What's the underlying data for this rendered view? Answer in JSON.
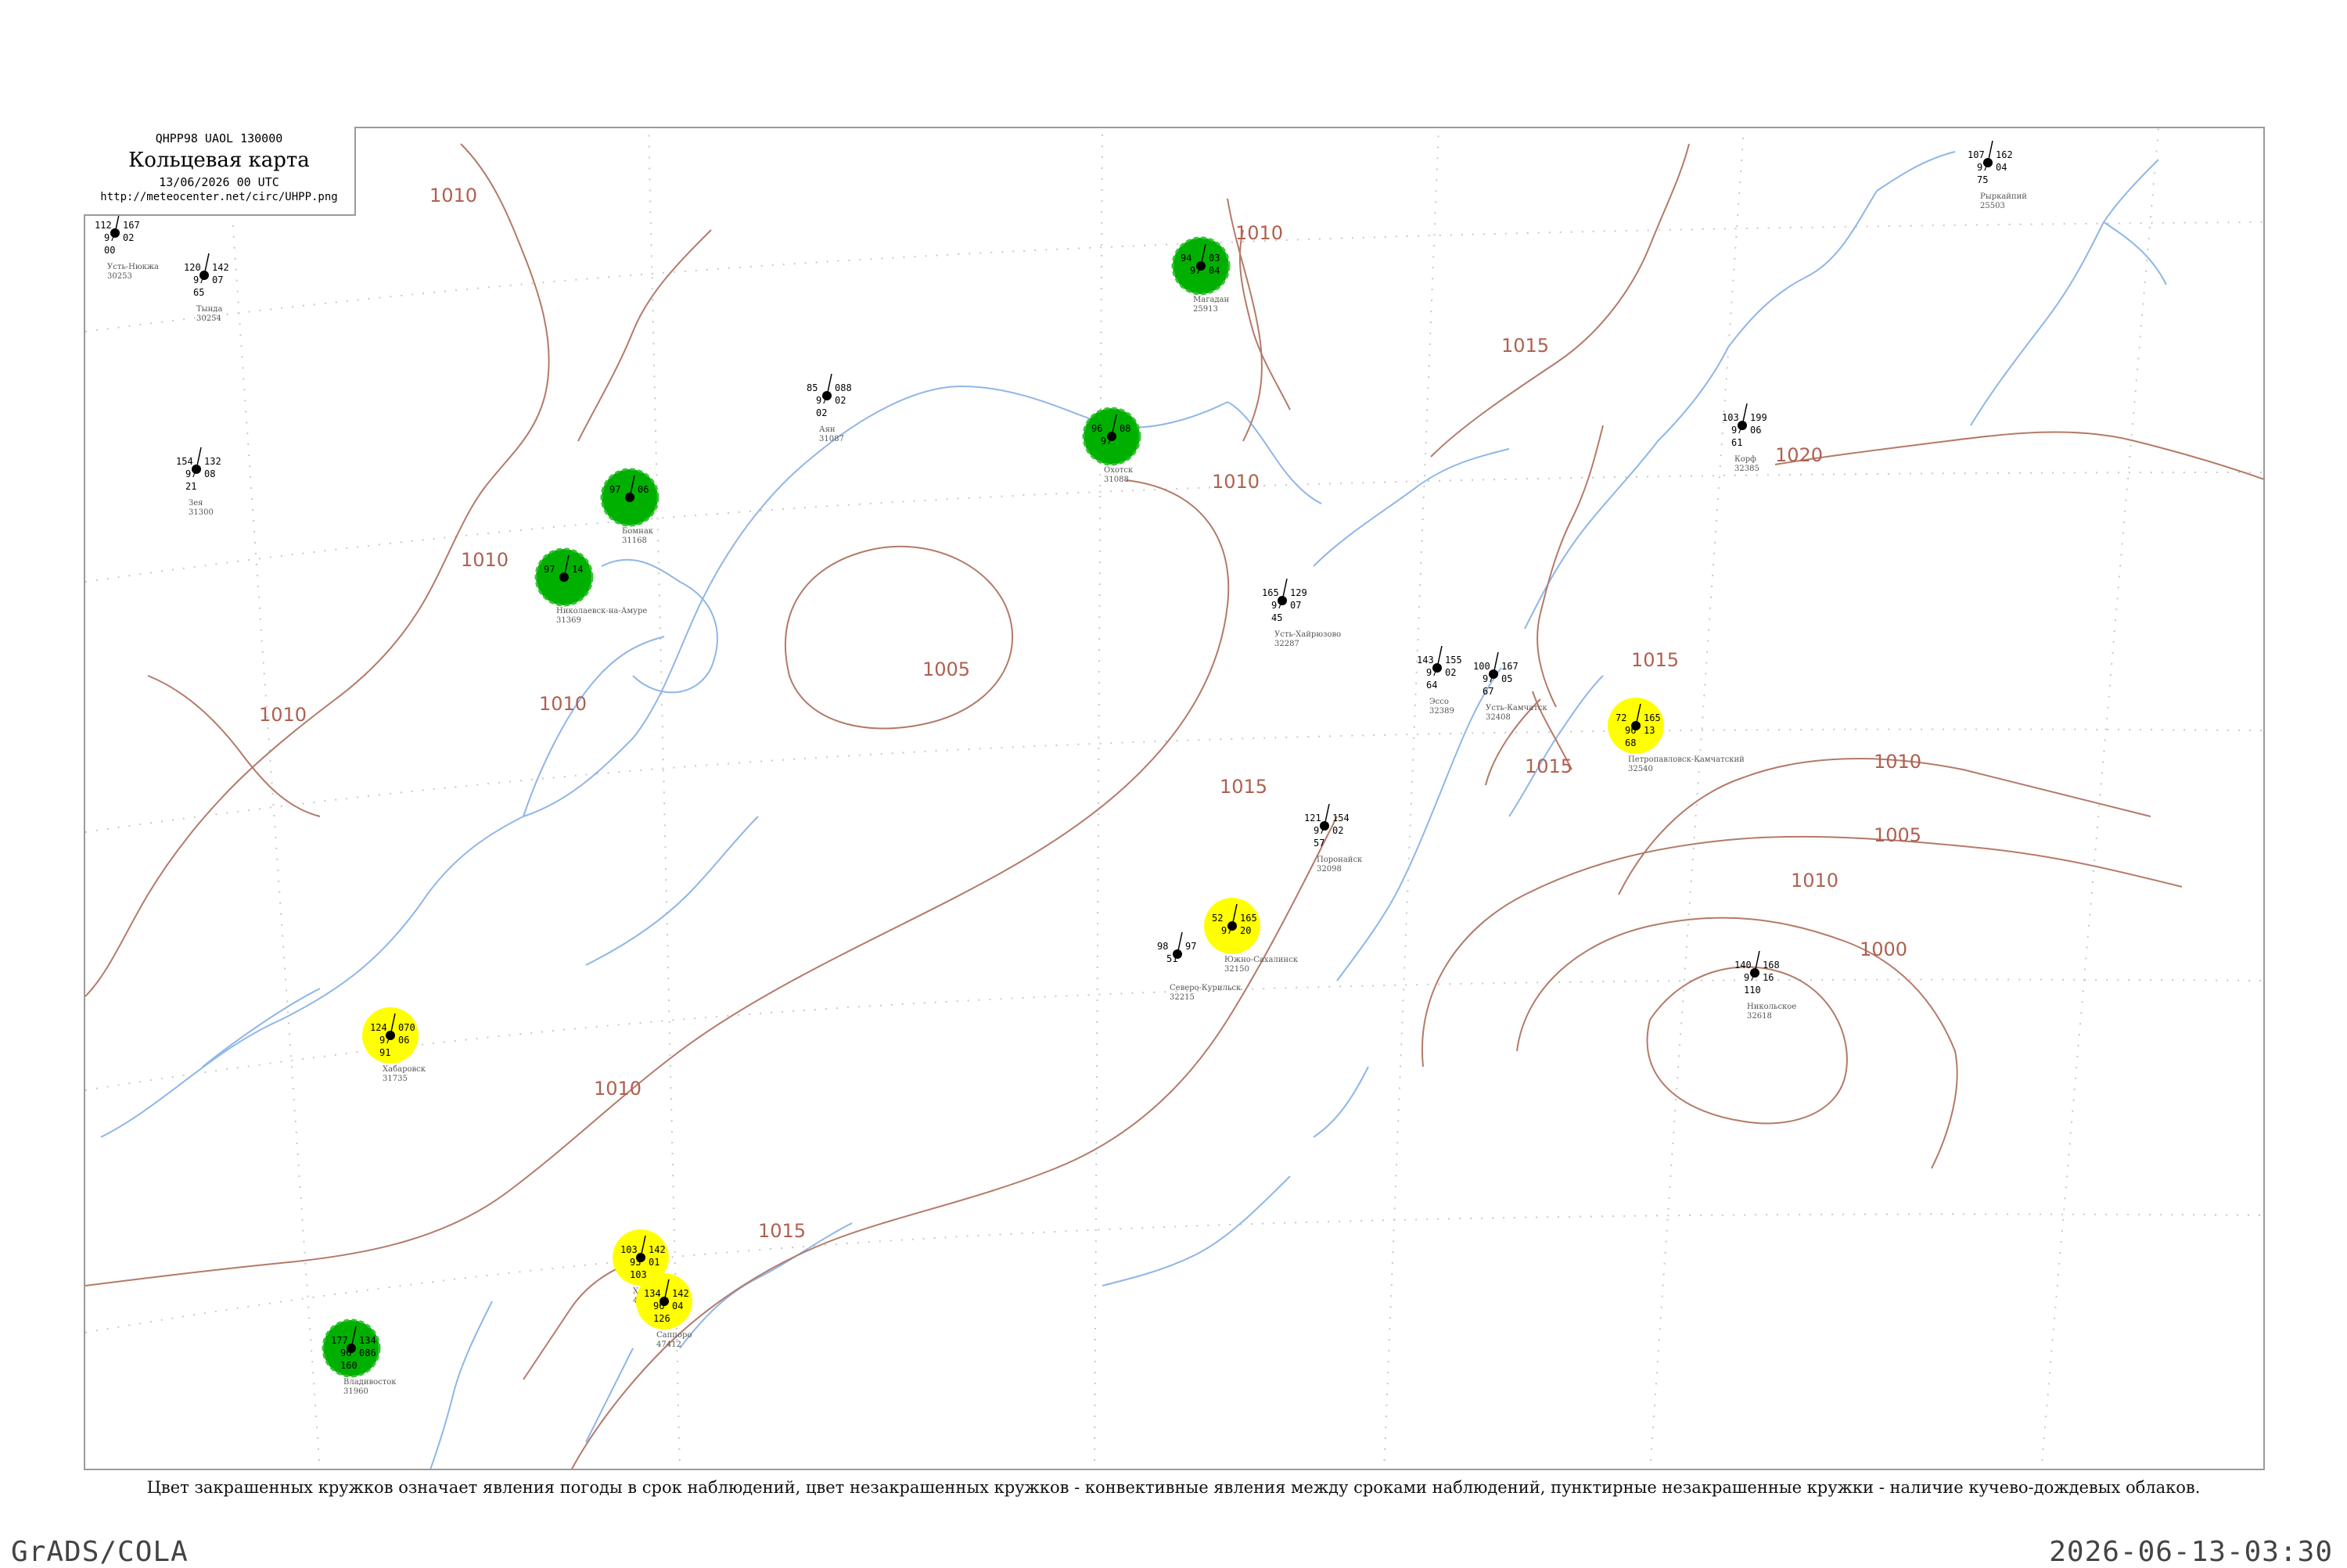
{
  "legend": {
    "code": "QHPP98  UAOL  130000",
    "title": "Кольцевая карта",
    "date": "13/06/2026 00 UTC",
    "url": "http://meteocenter.net/circ/UHPP.png"
  },
  "footnote": "Цвет закрашенных кружков означает явления погоды в срок наблюдений, цвет незакрашенных кружков - конвективные явления между сроками наблюдений, пунктирные незакрашенные кружки - наличие кучево-дождевых облаков.",
  "credit": "GrADS/COLA",
  "timestamp": "2026-06-13-03:30",
  "colors": {
    "isobar": "#b47a6a",
    "coast": "#8fb6e8",
    "green_fill": "#00b000",
    "green_ring": "#36c436",
    "yellow_fill": "#ffff00",
    "red_ring": "#e0506e",
    "grid": "#c8c8c8"
  },
  "isobar_labels": [
    "1010",
    "1010",
    "1010",
    "1010",
    "1010",
    "1010",
    "1005",
    "1010",
    "1015",
    "1015",
    "1015",
    "1020",
    "1015",
    "1010",
    "1005",
    "1000",
    "1015",
    "1010"
  ],
  "stations": [
    {
      "name": "Усть-Нюкжа",
      "id": "30253",
      "values": [
        "112",
        "167",
        "97",
        "02",
        "00"
      ],
      "marker": "none"
    },
    {
      "name": "Тында",
      "id": "30254",
      "values": [
        "120",
        "142",
        "97",
        "07",
        "65"
      ],
      "marker": "none"
    },
    {
      "name": "Зея",
      "id": "31300",
      "values": [
        "154",
        "132",
        "97",
        "08",
        "21"
      ],
      "marker": "none"
    },
    {
      "name": "Бомнак",
      "id": "31168",
      "values": [
        "97",
        "06"
      ],
      "marker": "filled-green"
    },
    {
      "name": "Николаевск-на-Амуре",
      "id": "31369",
      "values": [
        "97",
        "14"
      ],
      "marker": "filled-green"
    },
    {
      "name": "Охотск",
      "id": "31088",
      "values": [
        "96",
        "08",
        "97"
      ],
      "marker": "filled-green"
    },
    {
      "name": "Аян",
      "id": "31087",
      "values": [
        "85",
        "088",
        "97",
        "02",
        "02"
      ],
      "marker": "none"
    },
    {
      "name": "Магадан",
      "id": "25913",
      "values": [
        "94",
        "03",
        "97",
        "04"
      ],
      "marker": "filled-green"
    },
    {
      "name": "Хабаровск",
      "id": "31735",
      "values": [
        "124",
        "070",
        "97",
        "06",
        "91"
      ],
      "marker": "filled-yellow"
    },
    {
      "name": "Владивосток",
      "id": "31960",
      "values": [
        "177",
        "134",
        "96",
        "086",
        "160"
      ],
      "marker": "filled-green"
    },
    {
      "name": "Южно-Сахалинск",
      "id": "32150",
      "values": [
        "52",
        "165",
        "97",
        "20"
      ],
      "marker": "filled-yellow"
    },
    {
      "name": "Петропавловск-Камчатский",
      "id": "32540",
      "values": [
        "72",
        "165",
        "96",
        "13",
        "68"
      ],
      "marker": "filled-yellow"
    },
    {
      "name": "Усть-Камчатск",
      "id": "32408",
      "values": [
        "100",
        "167",
        "97",
        "05",
        "67"
      ],
      "marker": "none"
    },
    {
      "name": "Никольское",
      "id": "32618",
      "values": [
        "140",
        "168",
        "97",
        "16",
        "110"
      ],
      "marker": "none"
    },
    {
      "name": "Северо-Курильск",
      "id": "32215",
      "values": [
        "98",
        "97",
        "51"
      ],
      "marker": "none"
    },
    {
      "name": "Корф",
      "id": "32385",
      "values": [
        "103",
        "199",
        "97",
        "06",
        "61"
      ],
      "marker": "none"
    },
    {
      "name": "Хакодате",
      "id": "47430",
      "values": [
        "103",
        "142",
        "93",
        "01",
        "103"
      ],
      "marker": "filled-yellow"
    },
    {
      "name": "Саппоро",
      "id": "47412",
      "values": [
        "134",
        "142",
        "96",
        "04",
        "126"
      ],
      "marker": "filled-yellow"
    },
    {
      "name": "Рыркайпий",
      "id": "25503",
      "values": [
        "107",
        "162",
        "97",
        "04",
        "75"
      ],
      "marker": "none"
    },
    {
      "name": "Эссо",
      "id": "32389",
      "values": [
        "143",
        "155",
        "97",
        "02",
        "64"
      ],
      "marker": "none"
    },
    {
      "name": "Усть-Хайрюзово",
      "id": "32287",
      "values": [
        "165",
        "129",
        "97",
        "07",
        "45"
      ],
      "marker": "none"
    },
    {
      "name": "Поронайск",
      "id": "32098",
      "values": [
        "121",
        "154",
        "97",
        "02",
        "57"
      ],
      "marker": "none"
    }
  ]
}
